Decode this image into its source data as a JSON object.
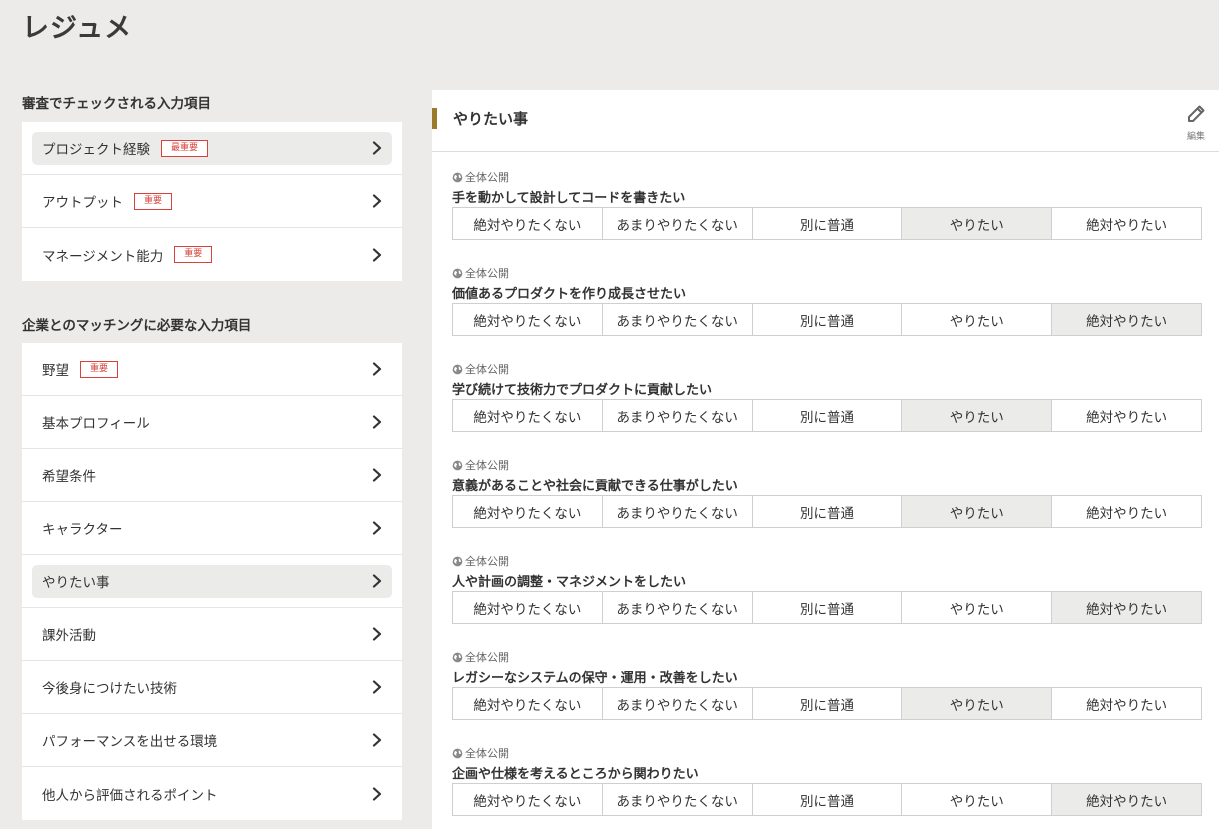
{
  "page_title": "レジュメ",
  "sections": [
    {
      "heading": "審査でチェックされる入力項目",
      "items": [
        {
          "label": "プロジェクト経験",
          "badge": "最重要",
          "active": true
        },
        {
          "label": "アウトプット",
          "badge": "重要",
          "active": false
        },
        {
          "label": "マネージメント能力",
          "badge": "重要",
          "active": false
        }
      ]
    },
    {
      "heading": "企業とのマッチングに必要な入力項目",
      "items": [
        {
          "label": "野望",
          "badge": "重要",
          "active": false
        },
        {
          "label": "基本プロフィール",
          "badge": "",
          "active": false
        },
        {
          "label": "希望条件",
          "badge": "",
          "active": false
        },
        {
          "label": "キャラクター",
          "badge": "",
          "active": false
        },
        {
          "label": "やりたい事",
          "badge": "",
          "active": true
        },
        {
          "label": "課外活動",
          "badge": "",
          "active": false
        },
        {
          "label": "今後身につけたい技術",
          "badge": "",
          "active": false
        },
        {
          "label": "パフォーマンスを出せる環境",
          "badge": "",
          "active": false
        },
        {
          "label": "他人から評価されるポイント",
          "badge": "",
          "active": false
        }
      ]
    }
  ],
  "panel": {
    "title": "やりたい事",
    "edit_label": "編集",
    "accent_color": "#9c7a2c",
    "options": [
      "絶対やりたくない",
      "あまりやりたくない",
      "別に普通",
      "やりたい",
      "絶対やりたい"
    ],
    "questions": [
      {
        "visibility": "全体公開",
        "title": "手を動かして設計してコードを書きたい",
        "selected": 3
      },
      {
        "visibility": "全体公開",
        "title": "価値あるプロダクトを作り成長させたい",
        "selected": 4
      },
      {
        "visibility": "全体公開",
        "title": "学び続けて技術力でプロダクトに貢献したい",
        "selected": 3
      },
      {
        "visibility": "全体公開",
        "title": "意義があることや社会に貢献できる仕事がしたい",
        "selected": 3
      },
      {
        "visibility": "全体公開",
        "title": "人や計画の調整・マネジメントをしたい",
        "selected": 4
      },
      {
        "visibility": "全体公開",
        "title": "レガシーなシステムの保守・運用・改善をしたい",
        "selected": 3
      },
      {
        "visibility": "全体公開",
        "title": "企画や仕様を考えるところから関わりたい",
        "selected": 4
      }
    ]
  },
  "colors": {
    "background": "#ecebe9",
    "badge": "#d9423b",
    "selected_option": "#ebebea"
  }
}
